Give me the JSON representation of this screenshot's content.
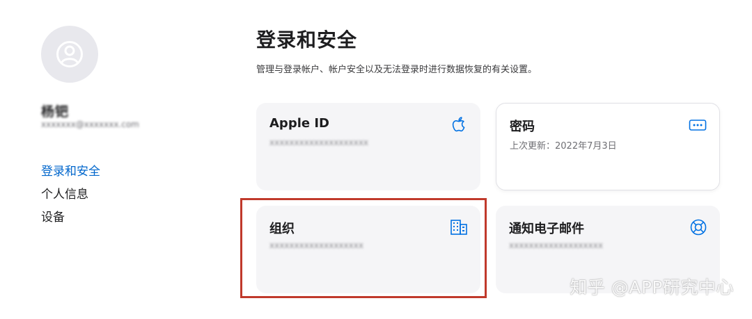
{
  "sidebar": {
    "user_name": "杨钯",
    "user_email": "xxxxxxx@xxxxxxx.com",
    "nav_items": [
      {
        "label": "登录和安全",
        "active": true
      },
      {
        "label": "个人信息",
        "active": false
      },
      {
        "label": "设备",
        "active": false
      }
    ]
  },
  "main": {
    "title": "登录和安全",
    "description": "管理与登录帐户、帐户安全以及无法登录时进行数据恢复的有关设置。",
    "cards": {
      "apple_id": {
        "title": "Apple ID",
        "subtitle": "xxxxxxxxxxxxxxxxxxxx",
        "icon": "apple-icon"
      },
      "password": {
        "title": "密码",
        "subtitle": "上次更新：2022年7月3日",
        "icon": "password-dots-icon"
      },
      "organization": {
        "title": "组织",
        "subtitle": "xxxxxxxxxxxxxxxxxxx",
        "icon": "building-icon"
      },
      "notification_email": {
        "title": "通知电子邮件",
        "subtitle": "xxxxxxxxxxxxxxxxxxx",
        "icon": "lifebuoy-icon"
      }
    }
  },
  "watermark": "知乎 @APP研究中心",
  "colors": {
    "accent": "#0066cc",
    "highlight": "#c0392b",
    "card_bg": "#f5f5f7"
  }
}
